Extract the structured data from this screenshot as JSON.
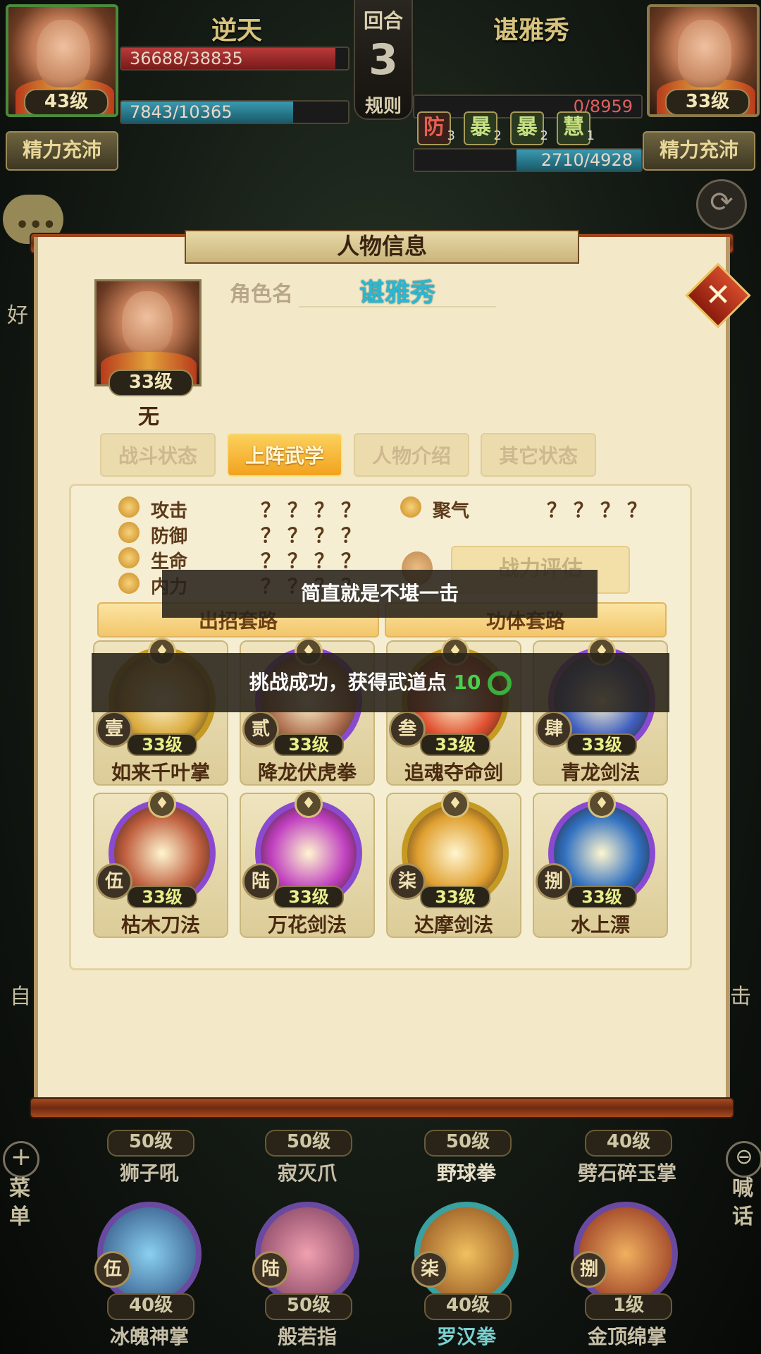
{
  "player_left": {
    "name": "逆天",
    "level": "43级",
    "hp": "36688/38835",
    "hp_fraction": 0.945,
    "mp": "7843/10365",
    "mp_fraction": 0.757,
    "status_button": "精力充沛"
  },
  "player_right": {
    "name": "谌雅秀",
    "level": "33级",
    "hp": "0/8959",
    "hp_fraction": 0.0,
    "mp": "2710/4928",
    "mp_fraction": 0.55,
    "status_button": "精力充沛"
  },
  "round": {
    "label": "回合",
    "number": "3",
    "rules": "规则"
  },
  "buffs": [
    {
      "glyph": "防",
      "count": "3",
      "color": "red"
    },
    {
      "glyph": "暴",
      "count": "2",
      "color": "green"
    },
    {
      "glyph": "暴",
      "count": "2",
      "color": "green"
    },
    {
      "glyph": "慧",
      "count": "1",
      "color": "green"
    }
  ],
  "left_side_partial": "好",
  "dialog": {
    "title": "人物信息",
    "role_label": "角色名",
    "role_name": "谌雅秀",
    "portrait_level": "33级",
    "sect": "无",
    "tabs": [
      {
        "label": "战斗状态",
        "active": false
      },
      {
        "label": "上阵武学",
        "active": true
      },
      {
        "label": "人物介绍",
        "active": false
      },
      {
        "label": "其它状态",
        "active": false
      }
    ],
    "stats": [
      {
        "label": "攻击",
        "value": "？？？？"
      },
      {
        "label": "防御",
        "value": "？？？？"
      },
      {
        "label": "生命",
        "value": "？？？？"
      },
      {
        "label": "内力",
        "value": "？？？？"
      }
    ],
    "stat_extra": {
      "label": "聚气",
      "value": "？？？？"
    },
    "eval_button": "战力评估",
    "route_tabs": [
      "出招套路",
      "功体套路"
    ],
    "skills": [
      {
        "num": "壹",
        "level": "33级",
        "name": "如来千叶掌",
        "ring": "gold",
        "art": "#d9a83a"
      },
      {
        "num": "贰",
        "level": "33级",
        "name": "降龙伏虎拳",
        "ring": "purple",
        "art": "#b07050"
      },
      {
        "num": "叁",
        "level": "33级",
        "name": "追魂夺命剑",
        "ring": "gold",
        "art": "#e05030"
      },
      {
        "num": "肆",
        "level": "33级",
        "name": "青龙剑法",
        "ring": "purple",
        "art": "#4060c0"
      },
      {
        "num": "伍",
        "level": "33级",
        "name": "枯木刀法",
        "ring": "purple",
        "art": "#c06040"
      },
      {
        "num": "陆",
        "level": "33级",
        "name": "万花剑法",
        "ring": "purple",
        "art": "#c040c0"
      },
      {
        "num": "柒",
        "level": "33级",
        "name": "达摩剑法",
        "ring": "gold",
        "art": "#e0a030"
      },
      {
        "num": "捌",
        "level": "33级",
        "name": "水上漂",
        "ring": "purple",
        "art": "#3070c0"
      }
    ]
  },
  "toasts": {
    "message1": "简直就是不堪一击",
    "message2_prefix": "挑战成功，获得武道点",
    "message2_value": "10"
  },
  "side_left": {
    "partial": "自",
    "menu": [
      "菜",
      "单"
    ]
  },
  "side_right": {
    "partial": "击",
    "shout": [
      "喊",
      "话"
    ]
  },
  "bottom_row1": [
    {
      "level": "50级",
      "name": "狮子吼"
    },
    {
      "level": "50级",
      "name": "寂灭爪"
    },
    {
      "level": "50级",
      "name": "野球拳"
    },
    {
      "level": "40级",
      "name": "劈石碎玉掌"
    }
  ],
  "bottom_row2": [
    {
      "num": "伍",
      "level": "40级",
      "name": "冰魄神掌"
    },
    {
      "num": "陆",
      "level": "50级",
      "name": "般若指"
    },
    {
      "num": "柒",
      "level": "40级",
      "name": "罗汉拳"
    },
    {
      "num": "捌",
      "level": "1级",
      "name": "金顶绵掌"
    }
  ]
}
